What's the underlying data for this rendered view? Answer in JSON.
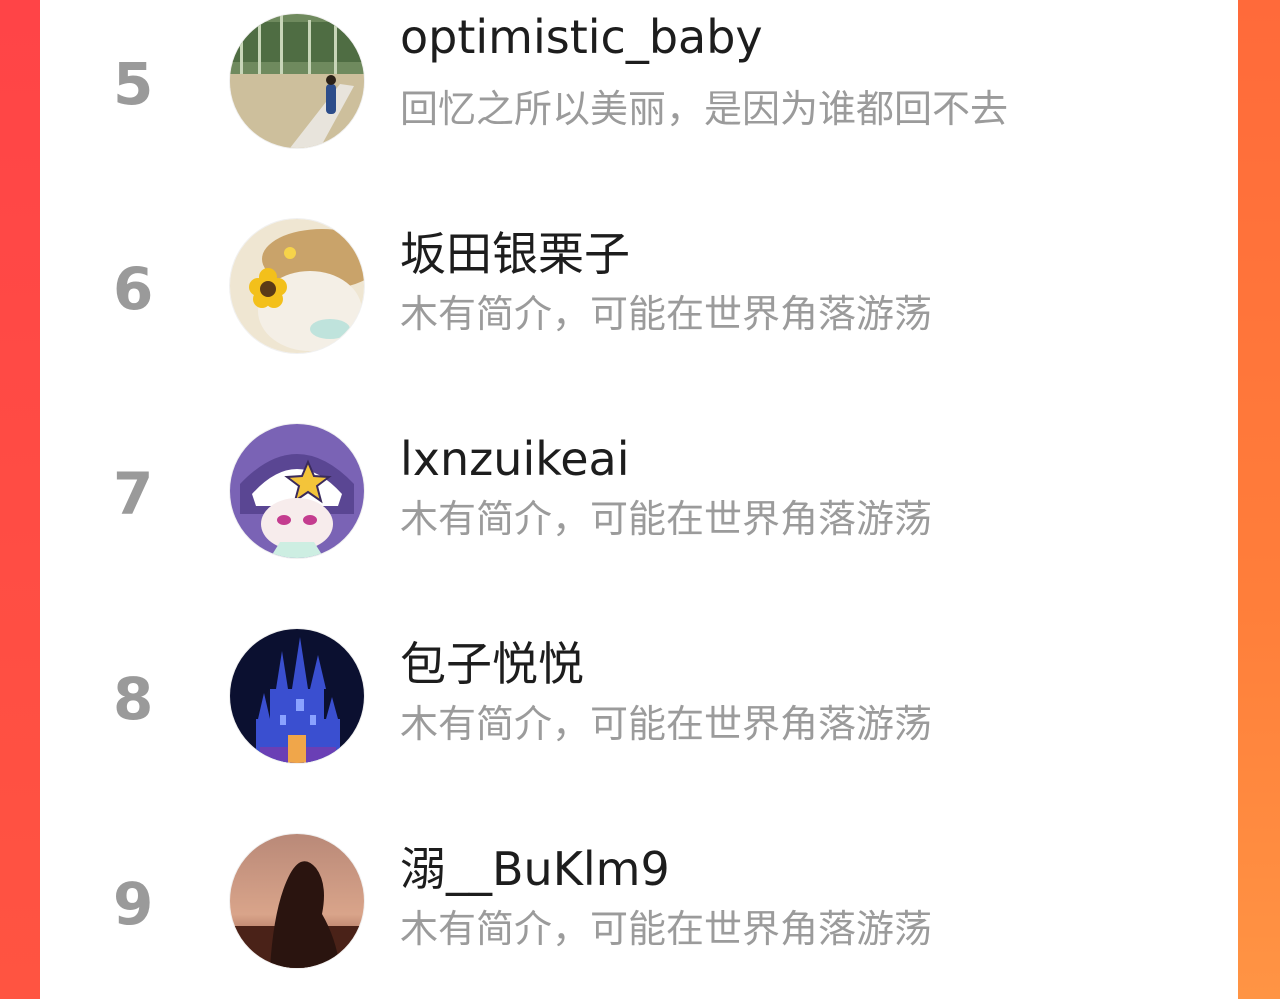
{
  "ranking": {
    "items": [
      {
        "rank": "5",
        "name": "optimistic_baby",
        "bio": "回忆之所以美丽，是因为谁都回不去",
        "avatar_icon": "field-path-photo-icon"
      },
      {
        "rank": "6",
        "name": "坂田银栗子",
        "bio": "木有简介，可能在世界角落游荡",
        "avatar_icon": "sunflower-plush-photo-icon"
      },
      {
        "rank": "7",
        "name": "lxnzuikeai",
        "bio": "木有简介，可能在世界角落游荡",
        "avatar_icon": "anime-star-hat-character-icon"
      },
      {
        "rank": "8",
        "name": "包子悦悦",
        "bio": "木有简介，可能在世界角落游荡",
        "avatar_icon": "night-castle-photo-icon"
      },
      {
        "rank": "9",
        "name": "溺__BuKlm9",
        "bio": "木有简介，可能在世界角落游荡",
        "avatar_icon": "sunset-silhouette-photo-icon"
      }
    ]
  },
  "colors": {
    "background_accent": "#ff5441",
    "rank_gray": "#9a9a9a",
    "name_text": "#1d1d1d",
    "bio_text": "#9b9b9b"
  }
}
